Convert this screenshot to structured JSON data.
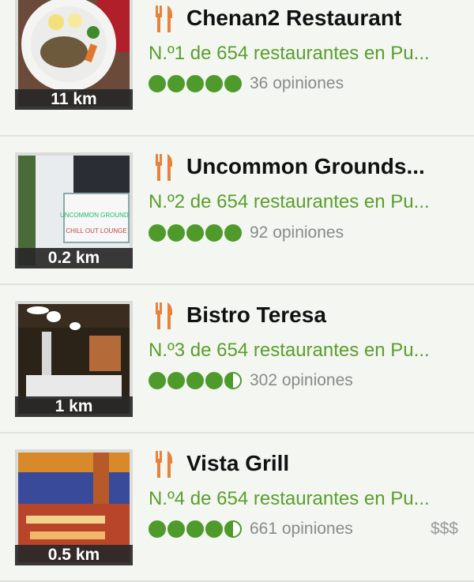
{
  "restaurants": [
    {
      "name": "Chenan2 Restaurant",
      "rank": "N.º1 de 654 restaurantes en Pu...",
      "rating": 5,
      "reviews": "36 opiniones",
      "distance": "11 km",
      "photo_icon": "plated-dish-photo",
      "price": ""
    },
    {
      "name": "Uncommon Grounds...",
      "rank": "N.º2 de 654 restaurantes en Pu...",
      "rating": 5,
      "reviews": "92 opiniones",
      "distance": "0.2 km",
      "photo_icon": "storefront-sign-photo",
      "photo_sign_line1": "UNCOMMON GROUNDS",
      "photo_sign_line2": "CHILL OUT LOUNGE",
      "price": ""
    },
    {
      "name": "Bistro Teresa",
      "rank": "N.º3 de 654 restaurantes en Pu...",
      "rating": 4.5,
      "reviews": "302 opiniones",
      "distance": "1 km",
      "photo_icon": "dining-room-photo",
      "price": ""
    },
    {
      "name": "Vista Grill",
      "rank": "N.º4 de 654 restaurantes en Pu...",
      "rating": 4.5,
      "reviews": "661 opiniones",
      "distance": "0.5 km",
      "photo_icon": "terrace-sunset-photo",
      "price": "$$$"
    }
  ],
  "colors": {
    "rank_green": "#5a9e2c",
    "bubble_green": "#4e9a2a",
    "fork_orange": "#e8823a"
  }
}
